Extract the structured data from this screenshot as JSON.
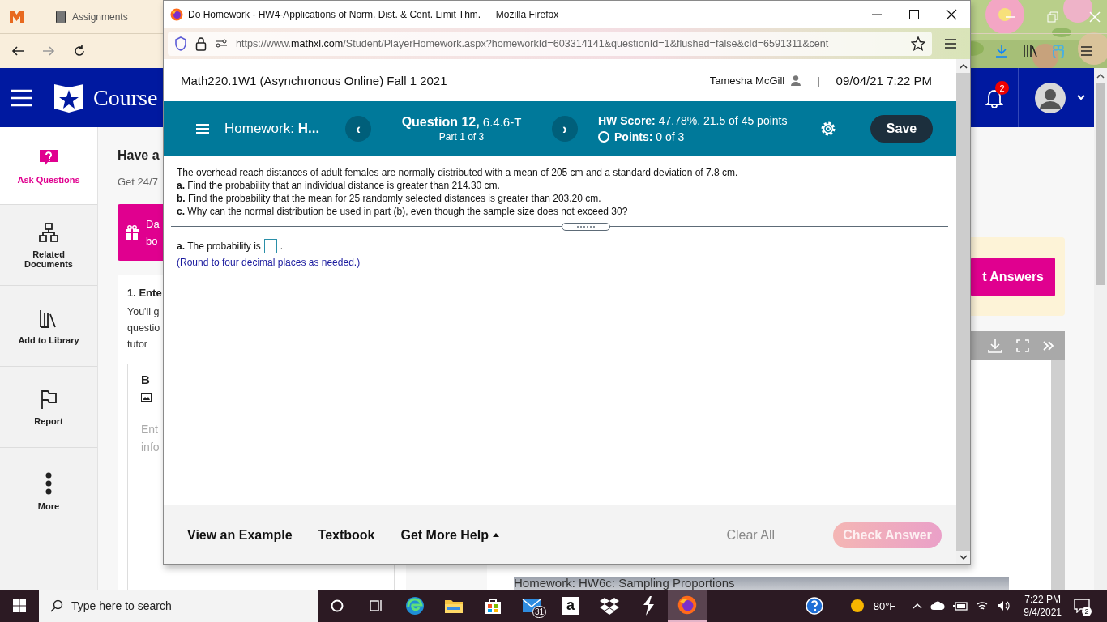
{
  "browser": {
    "tab": {
      "label": "Assignments"
    },
    "page": {
      "logo_text": "Course",
      "notification_badge": "2",
      "sidebar": {
        "items": [
          {
            "label": "Ask Questions",
            "selected": true
          },
          {
            "label": "Related Documents",
            "selected": false
          },
          {
            "label": "Add to Library",
            "selected": false
          },
          {
            "label": "Report",
            "selected": false
          },
          {
            "label": "More",
            "selected": false
          }
        ]
      },
      "heading": "Have a",
      "subtitle": "Get 24/7",
      "banner_lines": [
        "Da",
        "bo"
      ],
      "card": {
        "title": "1. Ente",
        "lines": [
          "You'll g",
          "questio",
          "tutor"
        ],
        "bold_tool": "B",
        "placeholder_lines": [
          "Ent",
          "info"
        ]
      },
      "answers_button": "t Answers",
      "document_title": "Homework: HW6c: Sampling Proportions"
    }
  },
  "popup": {
    "window_title": "Do Homework - HW4-Applications of Norm. Dist. & Cent. Limit Thm. — Mozilla Firefox",
    "url": {
      "scheme": "https://www.",
      "domain": "mathxl.com",
      "path": "/Student/PlayerHomework.aspx?homeworkId=603314141&questionId=1&flushed=false&cId=6591311&cent"
    },
    "course": "Math220.1W1 (Asynchronous Online) Fall 1 2021",
    "user": "Tamesha McGill",
    "separator": "|",
    "datetime": "09/04/21 7:22 PM",
    "toolbar": {
      "homework": "Homework: **H...**",
      "prev": "‹",
      "question": "**Question 12,** 6.4.6-T",
      "part": "Part 1 of 3",
      "next": "›",
      "score": "**HW Score:** 47.78%, 21.5 of 45 points",
      "points": "**Points:** 0 of 3",
      "save": "Save"
    },
    "question": [
      "The overhead reach distances of adult females are normally distributed with a mean of 205 cm and a standard deviation of 7.8 cm.",
      "**a.** Find the probability that an individual distance is greater than 214.30 cm.",
      "**b.** Find the probability that the mean for 25 randomly selected distances is greater than 203.20 cm.",
      "**c.** Why can the normal distribution be used in part (b), even though the sample size does not exceed 30?"
    ],
    "answer": {
      "prefix": "**a.** The probability is",
      "suffix": "."
    },
    "hint": "(Round to four decimal places as needed.)",
    "footer": {
      "links": [
        {
          "label": "View an Example",
          "menu": false
        },
        {
          "label": "Textbook",
          "menu": false
        },
        {
          "label": "Get More Help",
          "menu": true
        }
      ],
      "clear": "Clear All",
      "check_answer": {
        "label": "Check Answer",
        "disabled": true
      }
    }
  },
  "taskbar": {
    "search_placeholder": "Type here to search",
    "apps": [
      {
        "kind": "cortana",
        "selected": false
      },
      {
        "kind": "task-view",
        "selected": false
      },
      {
        "kind": "edge",
        "selected": false
      },
      {
        "kind": "explorer",
        "selected": false
      },
      {
        "kind": "store",
        "selected": false
      },
      {
        "kind": "mail",
        "badge": "31",
        "selected": false
      },
      {
        "kind": "amazon",
        "glyph": "a",
        "selected": false
      },
      {
        "kind": "dropbox",
        "selected": false
      },
      {
        "kind": "bolt",
        "selected": false
      },
      {
        "kind": "firefox",
        "selected": true
      }
    ],
    "weather": "80°F",
    "time": "7:22 PM",
    "date": "9/4/2021",
    "notifications": "2"
  }
}
